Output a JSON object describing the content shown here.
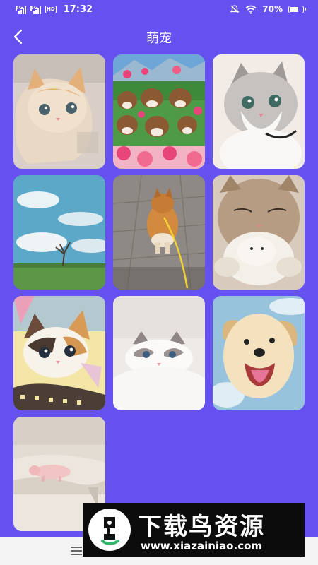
{
  "status_bar": {
    "sig1_label": "4G",
    "sig2_label": "5G",
    "hd_label": "HD",
    "time": "17:32",
    "battery_text": "70%",
    "battery_level": 0.7
  },
  "header": {
    "title": "萌宠",
    "back_icon": "back-arrow-icon"
  },
  "gallery": {
    "items": [
      {
        "name": "kitten-orange-fluffy"
      },
      {
        "name": "dogs-flowers-collage"
      },
      {
        "name": "cat-gray-white"
      },
      {
        "name": "landscape-tree-sky"
      },
      {
        "name": "corgi-walking"
      },
      {
        "name": "cat-hugging-pet"
      },
      {
        "name": "kitten-calico-colorful"
      },
      {
        "name": "kitten-ragdoll-white"
      },
      {
        "name": "puppy-golden-smiling"
      },
      {
        "name": "piglet-on-sofa"
      }
    ]
  },
  "bottom_bar": {
    "menu_icon": "menu-icon"
  },
  "watermark": {
    "title": "下载鸟资源",
    "url": "www.xiazainiao.com"
  },
  "colors": {
    "background": "#6550f0",
    "text": "#ffffff"
  }
}
